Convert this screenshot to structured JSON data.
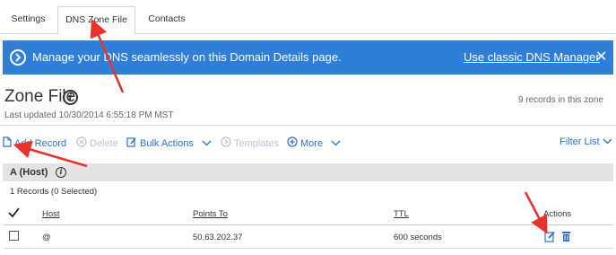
{
  "tabs": [
    {
      "label": "Settings"
    },
    {
      "label": "DNS Zone File"
    },
    {
      "label": "Contacts"
    }
  ],
  "banner": {
    "message": "Manage your DNS seamlessly on this Domain Details page.",
    "link": "Use classic DNS Manager",
    "close": "✕"
  },
  "zone": {
    "title": "Zone File",
    "info": "i",
    "updated": "Last updated 10/30/2014 6:55:18 PM MST",
    "records": "9 records in this zone"
  },
  "toolbar": {
    "add": "Add Record",
    "delete": "Delete",
    "bulk": "Bulk Actions",
    "templates": "Templates",
    "more": "More",
    "filter": "Filter List"
  },
  "section": {
    "label": "A (Host)",
    "selected": "1 Records (0 Selected)"
  },
  "table": {
    "headers": {
      "host": "Host",
      "points": "Points To",
      "ttl": "TTL",
      "actions": "Actions"
    },
    "rows": [
      {
        "host": "@",
        "points": "50.63.202.37",
        "ttl": "600 seconds"
      }
    ]
  },
  "colors": {
    "banner": "#2f7fd8",
    "link": "#2b71c7",
    "arrow": "#e8322b"
  }
}
